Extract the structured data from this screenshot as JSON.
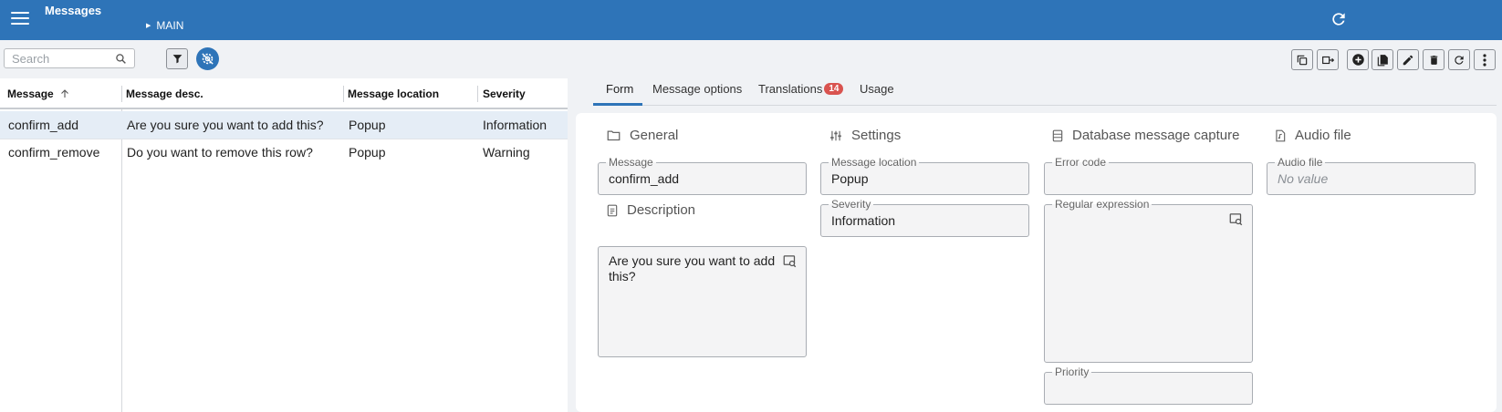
{
  "header": {
    "title": "Messages",
    "breadcrumb": "MAIN"
  },
  "toolbar": {
    "search_placeholder": "Search"
  },
  "grid": {
    "columns": [
      "Message",
      "Message desc.",
      "Message location",
      "Severity"
    ],
    "rows": [
      {
        "message": "confirm_add",
        "desc": "Are you sure you want to add this?",
        "location": "Popup",
        "severity": "Information"
      },
      {
        "message": "confirm_remove",
        "desc": "Do you want to remove this row?",
        "location": "Popup",
        "severity": "Warning"
      }
    ]
  },
  "tabs": {
    "items": [
      "Form",
      "Message options",
      "Translations",
      "Usage"
    ],
    "translations_badge": "14",
    "active": "Form"
  },
  "form": {
    "general_title": "General",
    "message_label": "Message",
    "message_value": "confirm_add",
    "description_title": "Description",
    "description_value": "Are you sure you want to add this?",
    "settings_title": "Settings",
    "location_label": "Message location",
    "location_value": "Popup",
    "severity_label": "Severity",
    "severity_value": "Information",
    "db_title": "Database message capture",
    "error_code_label": "Error code",
    "regex_label": "Regular expression",
    "priority_label": "Priority",
    "audio_title": "Audio file",
    "audio_label": "Audio file",
    "audio_value": "No value"
  },
  "colors": {
    "header": "#2e74b8",
    "selected_row": "#e5edf6",
    "badge": "#d9534f"
  }
}
